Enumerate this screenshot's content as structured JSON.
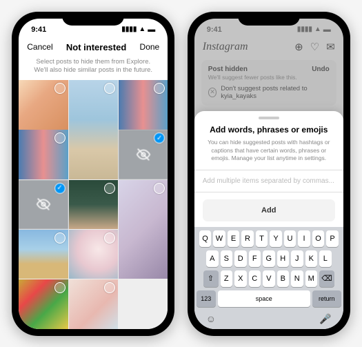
{
  "left": {
    "status_time": "9:41",
    "cancel": "Cancel",
    "title": "Not interested",
    "done": "Done",
    "subtitle": "Select posts to hide them from Explore. We'll also hide similar posts in the future.",
    "check": "✓"
  },
  "right": {
    "status_time": "9:41",
    "logo": "Instagram",
    "toast_title": "Post hidden",
    "toast_sub": "We'll suggest fewer posts like this.",
    "toast_undo": "Undo",
    "toast_related": "Don't suggest posts related to kyia_kayaks",
    "sheet_title": "Add words, phrases or emojis",
    "sheet_desc": "You can hide suggested posts with hashtags or captions that have certain words, phrases or emojis. Manage your list anytime in settings.",
    "input_placeholder": "Add multiple items separated by commas...",
    "add": "Add",
    "keys_r1": [
      "Q",
      "W",
      "E",
      "R",
      "T",
      "Y",
      "U",
      "I",
      "O",
      "P"
    ],
    "keys_r2": [
      "A",
      "S",
      "D",
      "F",
      "G",
      "H",
      "J",
      "K",
      "L"
    ],
    "keys_r3": [
      "Z",
      "X",
      "C",
      "V",
      "B",
      "N",
      "M"
    ],
    "key_shift": "⇧",
    "key_backspace": "⌫",
    "key_123": "123",
    "key_space": "space",
    "key_return": "return",
    "key_emoji": "☺",
    "key_mic": "🎤"
  }
}
